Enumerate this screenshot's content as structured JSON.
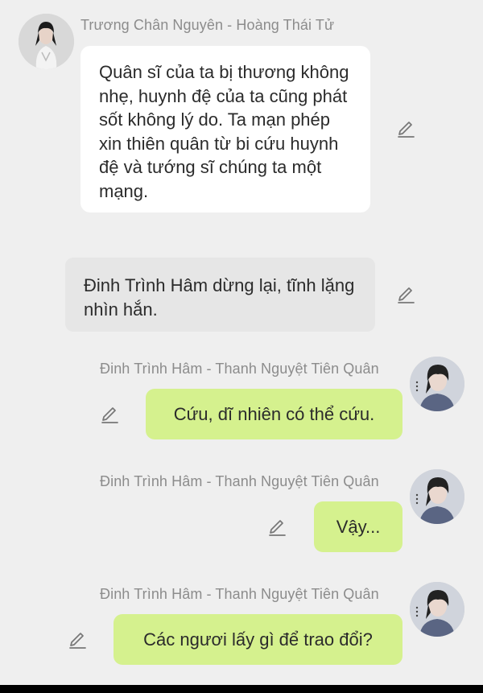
{
  "messages": [
    {
      "speaker": "Trương Chân Nguyên - Hoàng Thái Tử",
      "text": "Quân sĩ của ta bị thương không nhẹ, huynh đệ của ta cũng phát sốt không lý do. Ta mạn phép xin thiên quân từ bi cứu huynh đệ và tướng sĩ chúng ta một mạng.",
      "avatar_icon": "character-avatar-icon"
    },
    {
      "text": "Đinh Trình Hâm dừng lại, tĩnh lặng nhìn hắn."
    },
    {
      "speaker": "Đinh Trình Hâm - Thanh Nguyệt Tiên Quân",
      "text": "Cứu, dĩ nhiên có thể cứu.",
      "avatar_icon": "character-avatar-icon"
    },
    {
      "speaker": "Đinh Trình Hâm - Thanh Nguyệt Tiên Quân",
      "text": "Vậy...",
      "avatar_icon": "character-avatar-icon"
    },
    {
      "speaker": "Đinh Trình Hâm - Thanh Nguyệt Tiên Quân",
      "text": "Các ngươi lấy gì để trao đổi?",
      "avatar_icon": "character-avatar-icon"
    }
  ],
  "icons": {
    "edit": "pencil-edit-icon"
  },
  "colors": {
    "background": "#efefef",
    "bubble_incoming": "#ffffff",
    "bubble_narration": "#e6e6e6",
    "bubble_outgoing": "#d5f18e",
    "name_text": "#8c8c8c"
  }
}
